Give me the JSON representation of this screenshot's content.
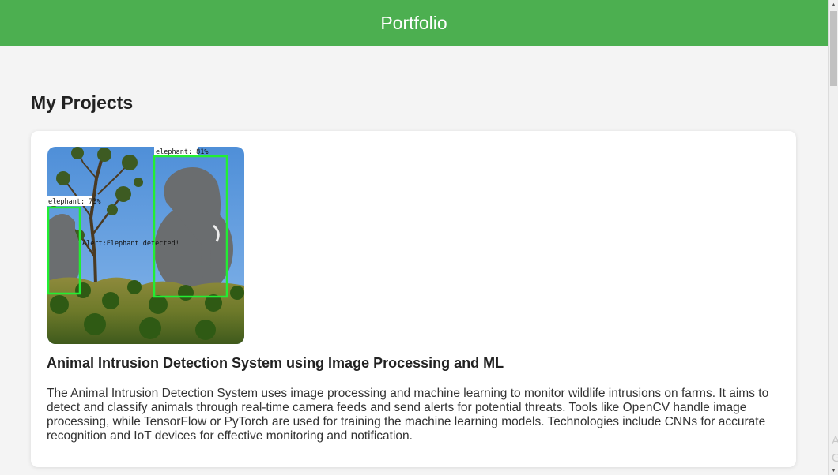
{
  "header": {
    "title": "Portfolio"
  },
  "projects_section": {
    "title": "My Projects"
  },
  "project": {
    "title": "Animal Intrusion Detection System using Image Processing and ML",
    "description": "The Animal Intrusion Detection System uses image processing and machine learning to monitor wildlife intrusions on farms. It aims to detect and classify animals through real-time camera feeds and send alerts for potential threats. Tools like OpenCV handle image processing, while TensorFlow or PyTorch are used for training the machine learning models. Technologies include CNNs for accurate recognition and IoT devices for effective monitoring and notification.",
    "image": {
      "labels": {
        "big": "elephant: 81%",
        "small": "elephant: 73%",
        "alert": "Alert:Elephant detected!"
      },
      "box_color": "#22ee33"
    }
  },
  "watermark": {
    "line1": "A",
    "line2": "G"
  },
  "colors": {
    "header": "#4caf50",
    "background": "#f4f4f4",
    "card": "#ffffff"
  }
}
